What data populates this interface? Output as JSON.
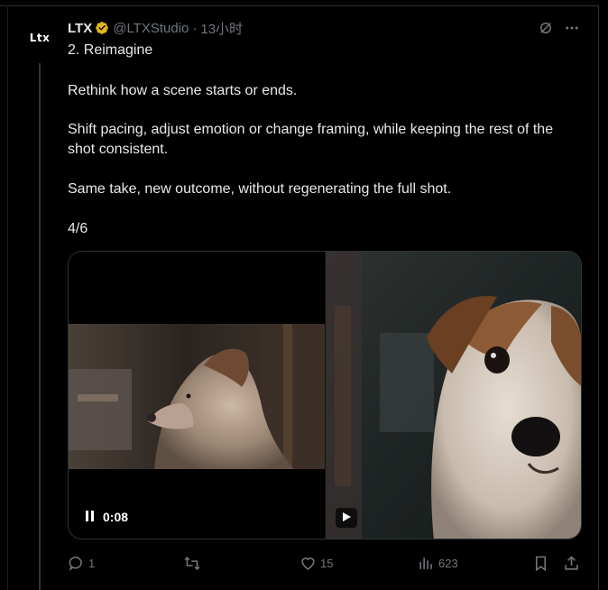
{
  "author": {
    "avatar_text": "Ltx",
    "name": "LTX",
    "handle": "@LTXStudio",
    "time": "13小时"
  },
  "tweet": {
    "line1": "2. Reimagine",
    "line2": "Rethink how a scene starts or ends.",
    "line3": "Shift pacing, adjust emotion or change framing, while keeping the rest of the shot consistent.",
    "line4": "Same take, new outcome, without regenerating the full shot.",
    "line5": "4/6"
  },
  "media": {
    "time_left": "0:08",
    "left_clip_desc": "dog-profile-video",
    "right_clip_desc": "dog-closeup-video"
  },
  "actions": {
    "reply_count": "1",
    "repost_count": "",
    "like_count": "15",
    "views_count": "623"
  },
  "colors": {
    "background": "#000000",
    "text": "#e7e9ea",
    "muted": "#71767b",
    "verified_gold": "#e2b719",
    "border": "#2f3336"
  },
  "icons": [
    "verified-badge-icon",
    "grok-icon",
    "more-icon",
    "pause-icon",
    "play-icon",
    "reply-icon",
    "repost-icon",
    "like-icon",
    "views-icon",
    "bookmark-icon",
    "share-icon"
  ]
}
